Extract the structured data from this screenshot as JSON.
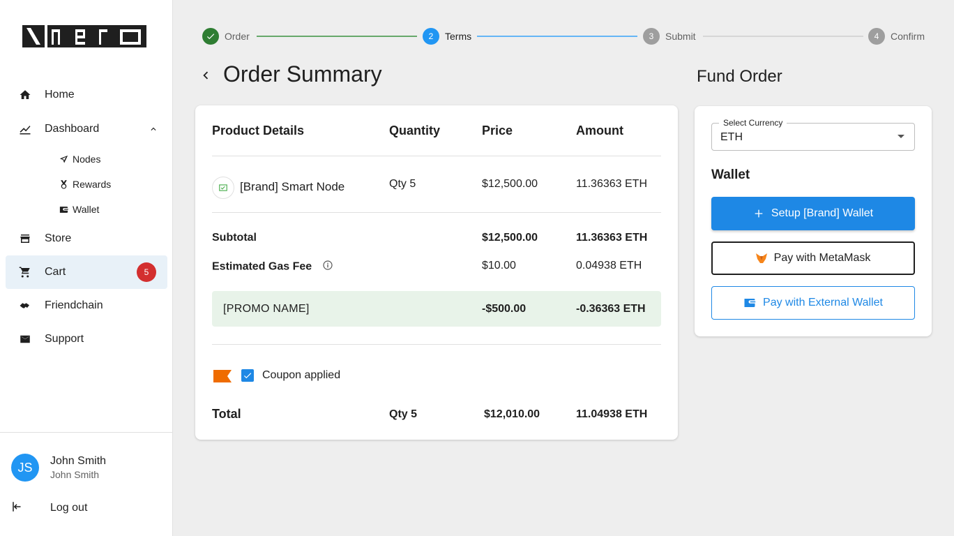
{
  "brand": {
    "logo_text": "nerd"
  },
  "sidebar": {
    "items": [
      {
        "label": "Home",
        "icon": "home-icon"
      },
      {
        "label": "Dashboard",
        "icon": "chart-icon",
        "expanded": true
      },
      {
        "label": "Nodes",
        "icon": "nodes-icon"
      },
      {
        "label": "Rewards",
        "icon": "medal-icon"
      },
      {
        "label": "Wallet",
        "icon": "wallet-icon"
      },
      {
        "label": "Store",
        "icon": "store-icon"
      },
      {
        "label": "Cart",
        "icon": "cart-icon",
        "badge": "5",
        "active": true
      },
      {
        "label": "Friendchain",
        "icon": "handshake-icon"
      },
      {
        "label": "Support",
        "icon": "mail-icon"
      }
    ],
    "user": {
      "initials": "JS",
      "name": "John Smith",
      "subtitle": "John Smith"
    },
    "logout_label": "Log out"
  },
  "stepper": {
    "steps": [
      {
        "number": "1",
        "label": "Order",
        "state": "completed"
      },
      {
        "number": "2",
        "label": "Terms",
        "state": "active"
      },
      {
        "number": "3",
        "label": "Submit",
        "state": "pending"
      },
      {
        "number": "4",
        "label": "Confirm",
        "state": "pending"
      }
    ]
  },
  "main": {
    "title": "Order Summary",
    "table": {
      "headers": [
        "Product Details",
        "Quantity",
        "Price",
        "Amount"
      ],
      "product": {
        "name": "[Brand] Smart Node",
        "qty": "Qty 5",
        "price": "$12,500.00",
        "amount": "11.36363 ETH"
      },
      "subtotal": {
        "label": "Subtotal",
        "price": "$12,500.00",
        "amount": "11.36363 ETH"
      },
      "gas_fee": {
        "label": "Estimated Gas Fee",
        "price": "$10.00",
        "amount": "0.04938 ETH"
      },
      "promo": {
        "label": "[PROMO NAME]",
        "price": "-$500.00",
        "amount": "-0.36363 ETH"
      },
      "coupon": {
        "label": "Coupon applied",
        "checked": true
      },
      "total": {
        "label": "Total",
        "qty": "Qty 5",
        "price": "$12,010.00",
        "amount": "11.04938 ETH"
      }
    }
  },
  "fund": {
    "title": "Fund Order",
    "currency_label": "Select Currency",
    "currency_value": "ETH",
    "wallet_title": "Wallet",
    "setup_button": "Setup [Brand] Wallet",
    "metamask_button": "Pay with MetaMask",
    "external_button": "Pay with External Wallet"
  },
  "colors": {
    "primary": "#1e88e5",
    "success": "#2e7d32",
    "badge": "#d32f2f",
    "promo_bg": "#e8f3e9"
  }
}
